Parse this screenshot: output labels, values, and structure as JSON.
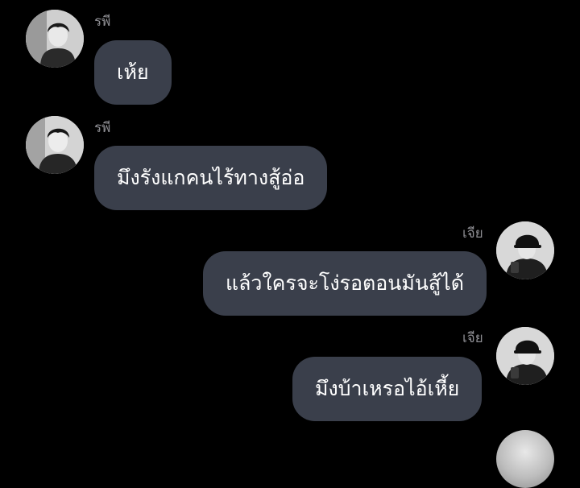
{
  "messages": [
    {
      "sender": "รพี",
      "text": "เห้ย",
      "side": "left",
      "avatar": "avatar-rapee"
    },
    {
      "sender": "รพี",
      "text": "มึงรังแกคนไร้ทางสู้อ่อ",
      "side": "left",
      "avatar": "avatar-rapee"
    },
    {
      "sender": "เจีย",
      "text": "แล้วใครจะโง่รอตอนมันสู้ได้",
      "side": "right",
      "avatar": "avatar-jia"
    },
    {
      "sender": "เจีย",
      "text": "มึงบ้าเหรอไอ้เหี้ย",
      "side": "right",
      "avatar": "avatar-jia"
    }
  ],
  "colors": {
    "background": "#000000",
    "bubble": "#3a3f4b",
    "text": "#ffffff",
    "name": "#8e8e93"
  }
}
